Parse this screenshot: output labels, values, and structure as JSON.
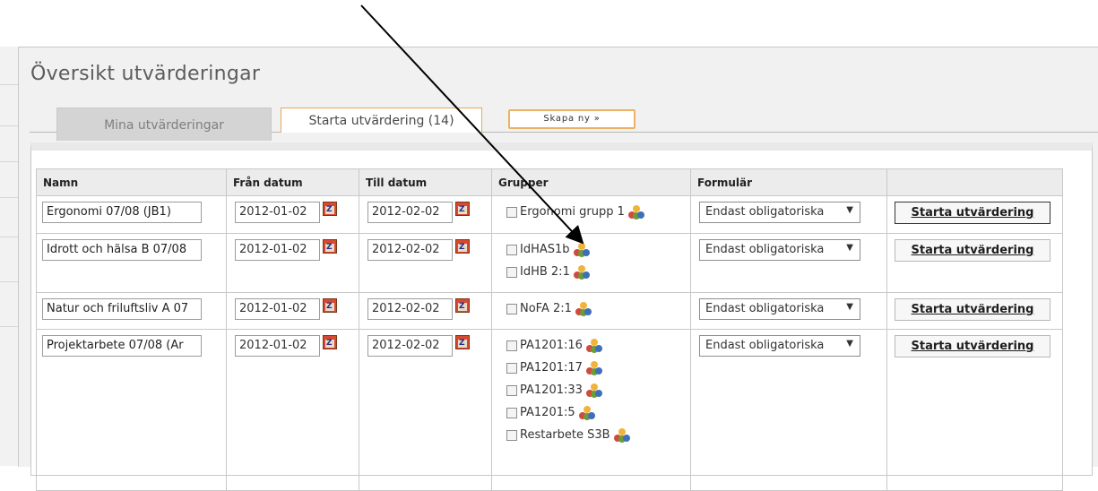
{
  "page": {
    "title": "Översikt utvärderingar"
  },
  "tabs": [
    {
      "label": "Mina utvärderingar"
    },
    {
      "label": "Starta utvärdering (14)"
    }
  ],
  "create_button": {
    "label": "Skapa ny »"
  },
  "table": {
    "headers": [
      "Namn",
      "Från datum",
      "Till datum",
      "Grupper",
      "Formulär",
      ""
    ],
    "rows": [
      {
        "name": "Ergonomi 07/08 (JB1)",
        "from": "2012-01-02",
        "to": "2012-02-02",
        "groups": [
          "Ergonomi grupp 1"
        ],
        "form": "Endast obligatoriska",
        "button": "Starta utvärdering"
      },
      {
        "name": "Idrott och hälsa B 07/08",
        "from": "2012-01-02",
        "to": "2012-02-02",
        "groups": [
          "IdHAS1b",
          "IdHB 2:1"
        ],
        "form": "Endast obligatoriska",
        "button": "Starta utvärdering"
      },
      {
        "name": "Natur och friluftsliv A 07",
        "from": "2012-01-02",
        "to": "2012-02-02",
        "groups": [
          "NoFA 2:1"
        ],
        "form": "Endast obligatoriska",
        "button": "Starta utvärdering"
      },
      {
        "name": "Projektarbete 07/08 (Ar",
        "from": "2012-01-02",
        "to": "2012-02-02",
        "groups": [
          "PA1201:16",
          "PA1201:17",
          "PA1201:33",
          "PA1201:5",
          "Restarbete S3B"
        ],
        "form": "Endast obligatoriska",
        "button": "Starta utvärdering"
      }
    ]
  },
  "icons": {
    "calendar": "calendar-icon",
    "group": "group-people-icon",
    "annotation": "annotation-arrow"
  },
  "colors": {
    "tab_accent": "#e7a955",
    "group_icon": [
      "#f0b43c",
      "#d14a3c",
      "#6a9c3a",
      "#3e6fb7"
    ]
  }
}
